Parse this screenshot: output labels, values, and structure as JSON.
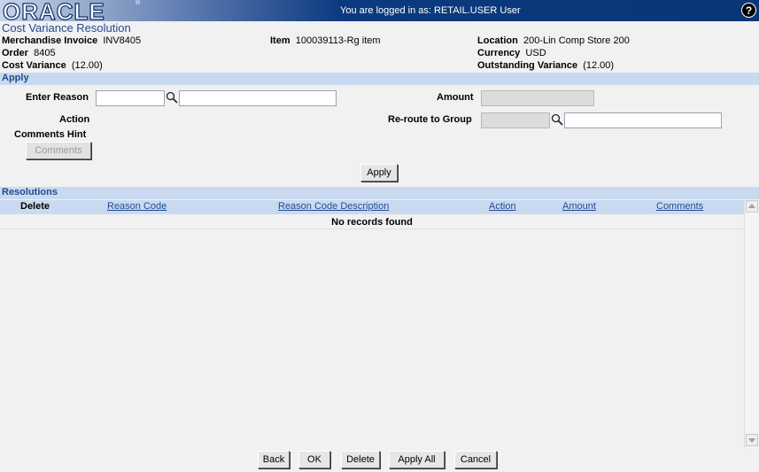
{
  "header": {
    "logo": "ORACLE",
    "login_text": "You are logged in as: RETAIL.USER User",
    "help_label": "?"
  },
  "page": {
    "title": "Cost Variance Resolution"
  },
  "info": {
    "merchandise_invoice_label": "Merchandise Invoice",
    "merchandise_invoice_value": "INV8405",
    "item_label": "Item",
    "item_value": "100039113-Rg item",
    "location_label": "Location",
    "location_value": "200-Lin Comp Store 200",
    "order_label": "Order",
    "order_value": "8405",
    "currency_label": "Currency",
    "currency_value": "USD",
    "cost_variance_label": "Cost Variance",
    "cost_variance_value": "(12.00)",
    "outstanding_variance_label": "Outstanding Variance",
    "outstanding_variance_value": "(12.00)"
  },
  "apply_section": {
    "title": "Apply",
    "enter_reason_label": "Enter Reason",
    "enter_reason_code": "",
    "enter_reason_desc": "",
    "amount_label": "Amount",
    "amount_value": "",
    "action_label": "Action",
    "reroute_label": "Re-route to Group",
    "reroute_code": "",
    "reroute_desc": "",
    "comments_hint_label": "Comments Hint",
    "comments_button": "Comments",
    "apply_button": "Apply"
  },
  "resolutions": {
    "title": "Resolutions",
    "columns": [
      "Delete",
      "Reason Code",
      "Reason Code Description",
      "Action",
      "Amount",
      "Comments"
    ],
    "empty_text": "No records found"
  },
  "footer_buttons": {
    "back": "Back",
    "ok": "OK",
    "delete": "Delete",
    "apply_all": "Apply All",
    "cancel": "Cancel"
  },
  "colors": {
    "section_bg": "#c9daf0",
    "title_color": "#1f4b8e",
    "banner_dark": "#0a3676"
  }
}
